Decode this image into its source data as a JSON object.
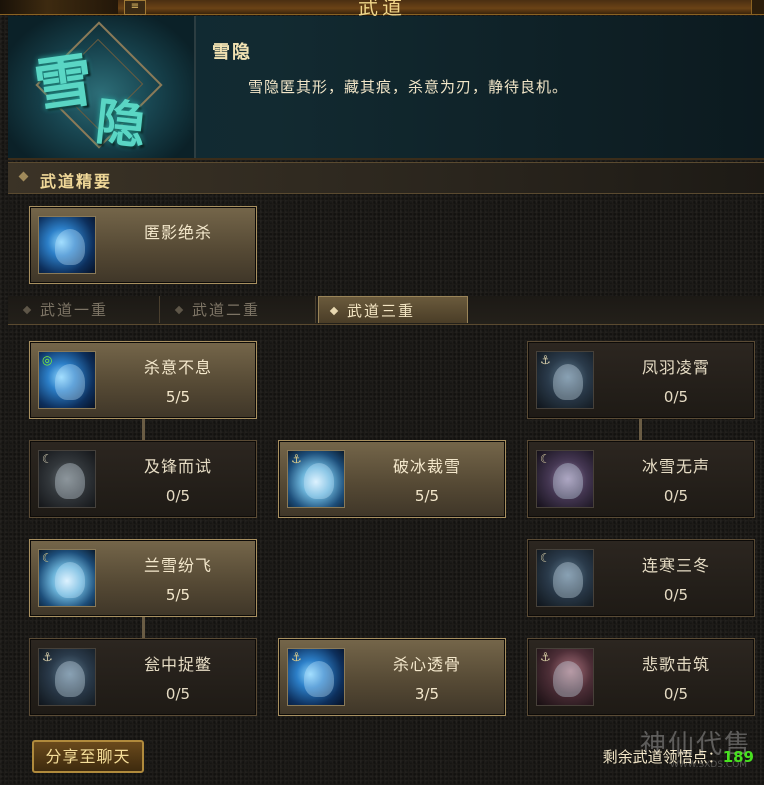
{
  "window": {
    "title": "武道",
    "menu_icon": "≡"
  },
  "banner": {
    "image_glyphs": [
      "雪",
      "隐"
    ],
    "skill_name": "雪隐",
    "description": "雪隐匿其形，藏其痕，杀意为刃，静待良机。"
  },
  "essentials": {
    "heading": "武道精要",
    "skill": {
      "name": "匿影绝杀",
      "icon": "shadow-assassin-icon"
    }
  },
  "tabs": [
    {
      "label": "武道一重",
      "active": false
    },
    {
      "label": "武道二重",
      "active": false
    },
    {
      "label": "武道三重",
      "active": true
    }
  ],
  "skills": [
    {
      "name": "杀意不息",
      "level": "5/5",
      "state": "learned",
      "icon": "killing-intent-icon"
    },
    {
      "name": "凤羽凌霄",
      "level": "0/5",
      "state": "locked",
      "icon": "phoenix-feather-icon"
    },
    {
      "name": "及锋而试",
      "level": "0/5",
      "state": "locked",
      "icon": "blade-trial-icon"
    },
    {
      "name": "破冰裁雪",
      "level": "5/5",
      "state": "learned",
      "icon": "ice-break-icon"
    },
    {
      "name": "冰雪无声",
      "level": "0/5",
      "state": "locked",
      "icon": "silent-snow-icon"
    },
    {
      "name": "兰雪纷飞",
      "level": "5/5",
      "state": "learned",
      "icon": "orchid-snow-icon"
    },
    {
      "name": "连寒三冬",
      "level": "0/5",
      "state": "locked",
      "icon": "triple-winter-icon"
    },
    {
      "name": "瓮中捉鳖",
      "level": "0/5",
      "state": "locked",
      "icon": "trap-icon"
    },
    {
      "name": "杀心透骨",
      "level": "3/5",
      "state": "learned",
      "icon": "piercing-heart-icon"
    },
    {
      "name": "悲歌击筑",
      "level": "0/5",
      "state": "locked",
      "icon": "sorrow-song-icon"
    }
  ],
  "footer": {
    "share_label": "分享至聊天",
    "remaining_label": "剩余武道领悟点：",
    "remaining_value": "189"
  },
  "watermark": {
    "text": "神仙代售",
    "url": "WWW.SXDS.COM"
  },
  "colors": {
    "accent_gold": "#f0d898",
    "points_green": "#48e020",
    "learned_card": "#75664a"
  }
}
